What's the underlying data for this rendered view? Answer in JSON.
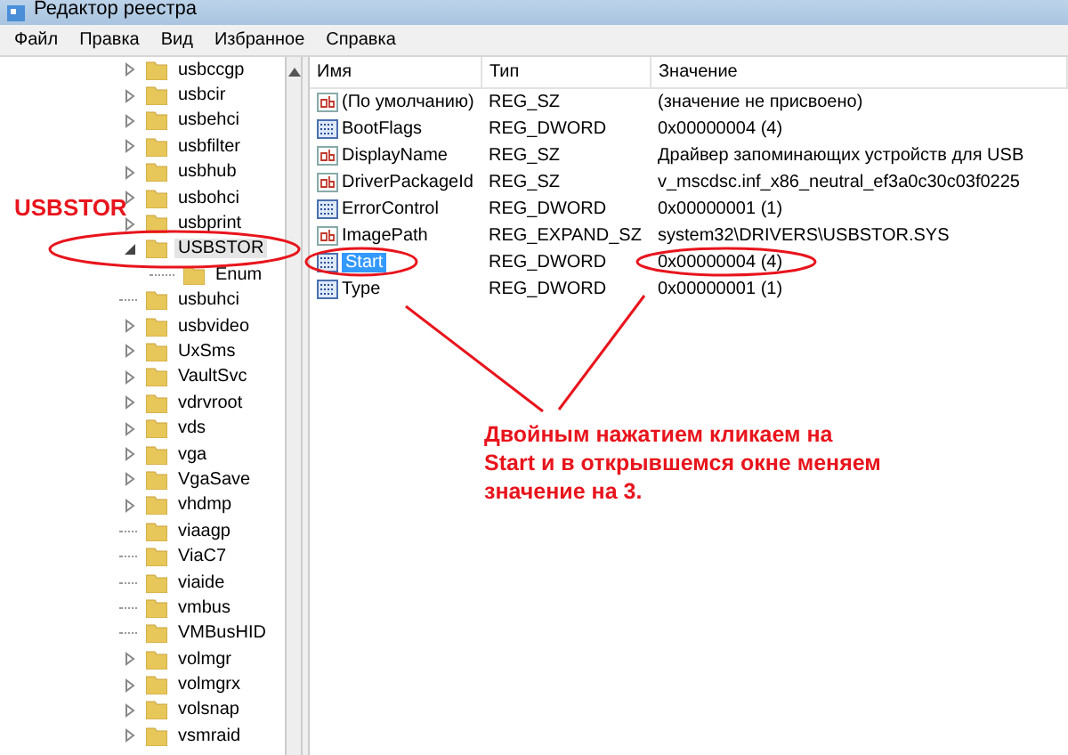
{
  "window": {
    "title": "Редактор реестра"
  },
  "menu": [
    "Файл",
    "Правка",
    "Вид",
    "Избранное",
    "Справка"
  ],
  "tree": [
    {
      "label": "usbccgp",
      "kind": "branch",
      "expanded": false,
      "selected": false
    },
    {
      "label": "usbcir",
      "kind": "branch",
      "expanded": false,
      "selected": false
    },
    {
      "label": "usbehci",
      "kind": "branch",
      "expanded": false,
      "selected": false
    },
    {
      "label": "usbfilter",
      "kind": "branch",
      "expanded": false,
      "selected": false
    },
    {
      "label": "usbhub",
      "kind": "branch",
      "expanded": false,
      "selected": false
    },
    {
      "label": "usbohci",
      "kind": "branch",
      "expanded": false,
      "selected": false
    },
    {
      "label": "usbprint",
      "kind": "branch",
      "expanded": false,
      "selected": false
    },
    {
      "label": "USBSTOR",
      "kind": "branch",
      "expanded": true,
      "selected": true,
      "children": [
        {
          "label": "Enum",
          "kind": "leaf",
          "selected": false
        }
      ]
    },
    {
      "label": "usbuhci",
      "kind": "leaf",
      "selected": false
    },
    {
      "label": "usbvideo",
      "kind": "branch",
      "expanded": false,
      "selected": false
    },
    {
      "label": "UxSms",
      "kind": "branch",
      "expanded": false,
      "selected": false
    },
    {
      "label": "VaultSvc",
      "kind": "branch",
      "expanded": false,
      "selected": false
    },
    {
      "label": "vdrvroot",
      "kind": "branch",
      "expanded": false,
      "selected": false
    },
    {
      "label": "vds",
      "kind": "branch",
      "expanded": false,
      "selected": false
    },
    {
      "label": "vga",
      "kind": "branch",
      "expanded": false,
      "selected": false
    },
    {
      "label": "VgaSave",
      "kind": "branch",
      "expanded": false,
      "selected": false
    },
    {
      "label": "vhdmp",
      "kind": "branch",
      "expanded": false,
      "selected": false
    },
    {
      "label": "viaagp",
      "kind": "leaf",
      "selected": false
    },
    {
      "label": "ViaC7",
      "kind": "leaf",
      "selected": false
    },
    {
      "label": "viaide",
      "kind": "leaf",
      "selected": false
    },
    {
      "label": "vmbus",
      "kind": "leaf",
      "selected": false
    },
    {
      "label": "VMBusHID",
      "kind": "leaf",
      "selected": false
    },
    {
      "label": "volmgr",
      "kind": "branch",
      "expanded": false,
      "selected": false
    },
    {
      "label": "volmgrx",
      "kind": "branch",
      "expanded": false,
      "selected": false
    },
    {
      "label": "volsnap",
      "kind": "branch",
      "expanded": false,
      "selected": false
    },
    {
      "label": "vsmraid",
      "kind": "branch",
      "expanded": false,
      "selected": false
    }
  ],
  "values": {
    "columns": [
      "Имя",
      "Тип",
      "Значение"
    ],
    "rows": [
      {
        "name": "(По умолчанию)",
        "type": "REG_SZ",
        "value": "(значение не присвоено)",
        "kind": "string",
        "selected": false
      },
      {
        "name": "BootFlags",
        "type": "REG_DWORD",
        "value": "0x00000004 (4)",
        "kind": "binary",
        "selected": false
      },
      {
        "name": "DisplayName",
        "type": "REG_SZ",
        "value": "Драйвер запоминающих устройств для USB",
        "kind": "string",
        "selected": false
      },
      {
        "name": "DriverPackageId",
        "type": "REG_SZ",
        "value": "v_mscdsc.inf_x86_neutral_ef3a0c30c03f0225",
        "kind": "string",
        "selected": false
      },
      {
        "name": "ErrorControl",
        "type": "REG_DWORD",
        "value": "0x00000001 (1)",
        "kind": "binary",
        "selected": false
      },
      {
        "name": "ImagePath",
        "type": "REG_EXPAND_SZ",
        "value": "system32\\DRIVERS\\USBSTOR.SYS",
        "kind": "string",
        "selected": false
      },
      {
        "name": "Start",
        "type": "REG_DWORD",
        "value": "0x00000004 (4)",
        "kind": "binary",
        "selected": true
      },
      {
        "name": "Type",
        "type": "REG_DWORD",
        "value": "0x00000001 (1)",
        "kind": "binary",
        "selected": false
      }
    ]
  },
  "annotations": {
    "label": "USBSTOR",
    "callout": [
      "Двойным нажатием кликаем на",
      "Start и в открывшемся окне меняем",
      "значение на 3."
    ]
  }
}
